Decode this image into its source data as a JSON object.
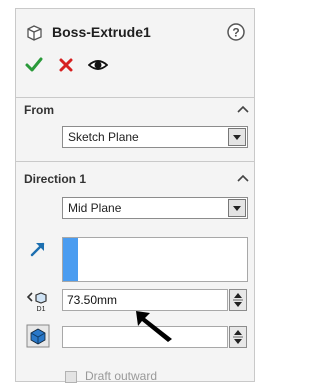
{
  "feature": {
    "title": "Boss-Extrude1",
    "icon": "extrude-box-icon",
    "help_icon": "help-icon"
  },
  "actions": {
    "ok": {
      "icon": "checkmark-icon",
      "color": "#2a9a3a"
    },
    "cancel": {
      "icon": "x-icon",
      "color": "#d62020"
    },
    "preview": {
      "icon": "eye-icon"
    }
  },
  "from": {
    "title": "From",
    "start_condition": "Sketch Plane"
  },
  "direction1": {
    "title": "Direction 1",
    "end_condition": "Mid Plane",
    "direction_selection_color": "#4a9cf0",
    "depth_label": "D1",
    "depth_value": "73.50mm",
    "draft_outward_label": "Draft outward",
    "draft_outward_checked": false
  },
  "colors": {
    "panel_bg": "#f4f4f4",
    "accent_blue": "#4a9cf0",
    "ok_green": "#2a9a3a",
    "cancel_red": "#d62020",
    "direction_arrow": "#1c6fb0"
  }
}
